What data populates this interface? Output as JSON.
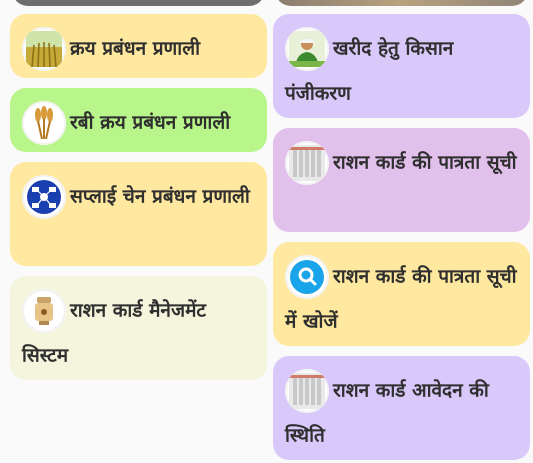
{
  "colors": {
    "yellow": "#ffe9a0",
    "green": "#b8f58a",
    "cream": "#f4f5dc",
    "lavender": "#d9c9fb",
    "pink_lavender": "#e2c0ec"
  },
  "left_cards": [
    {
      "label": "क्रय प्रबंधन प्रणाली",
      "icon": "wheat-field-icon"
    },
    {
      "label": "रबी क्रय प्रबंधन प्रणाली",
      "icon": "wheat-icon"
    },
    {
      "label": "सप्लाई चेन प्रबंधन प्रणाली",
      "icon": "supply-chain-icon"
    },
    {
      "label": "राशन कार्ड मैनेजमेंट सिस्टम",
      "icon": "emblem-icon"
    }
  ],
  "right_cards": [
    {
      "label": "खरीद हेतु किसान पंजीकरण",
      "icon": "farmer-icon"
    },
    {
      "label": "राशन कार्ड की पात्रता सूची",
      "icon": "document-list-icon"
    },
    {
      "label": "राशन कार्ड की पात्रता सूची में खोजें",
      "icon": "search-icon"
    },
    {
      "label": "राशन कार्ड आवेदन की स्थिति",
      "icon": "document-list-icon"
    }
  ]
}
